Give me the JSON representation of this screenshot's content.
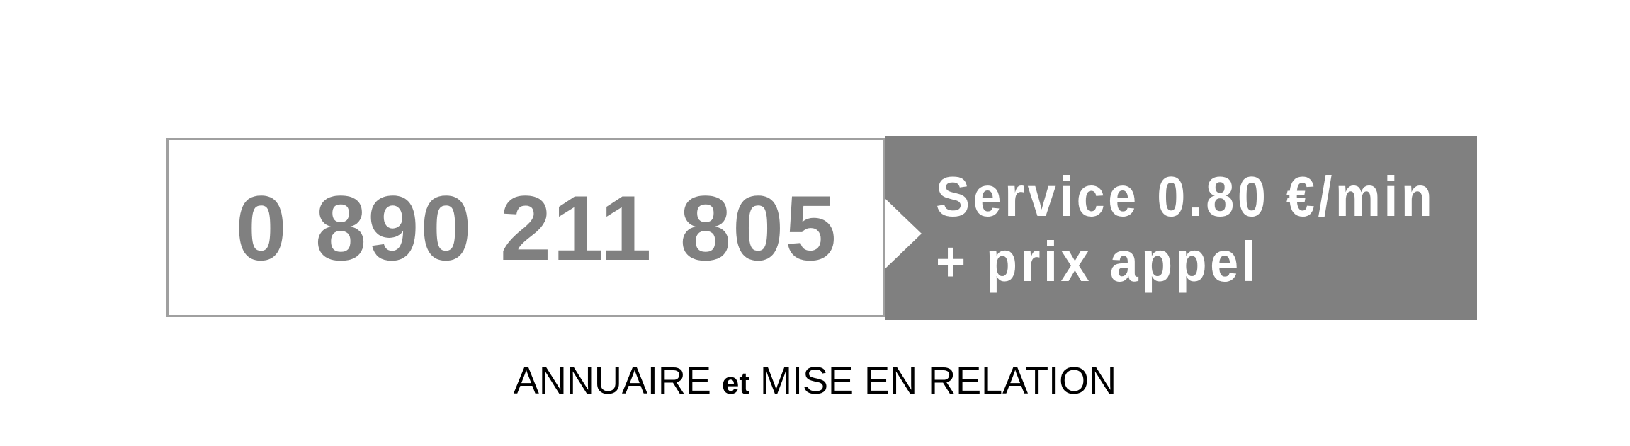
{
  "phone": {
    "number": "0 890 211 805"
  },
  "service": {
    "line1": "Service 0.80 €/min",
    "line2": "+ prix appel"
  },
  "caption": {
    "part1": "ANNUAIRE ",
    "part2": "et",
    "part3": " MISE EN RELATION"
  },
  "colors": {
    "gray": "#808080",
    "border": "#a0a0a0",
    "text_on_gray": "#ffffff"
  }
}
